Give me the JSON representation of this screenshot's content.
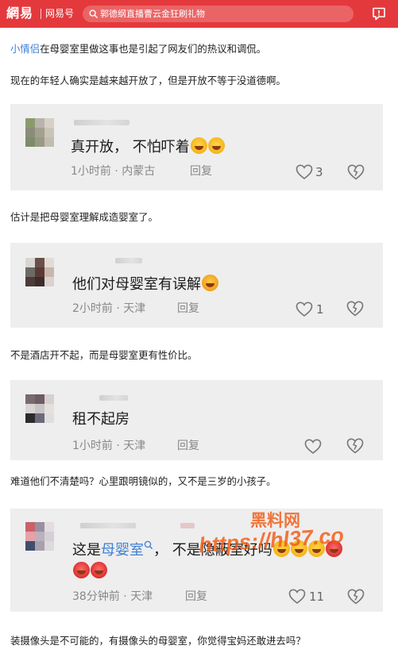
{
  "header": {
    "logo": "網易",
    "channel": "网易号",
    "search_text": "郭德纲直播曹云金狂刷礼物"
  },
  "article": {
    "p1_link": "小情侣",
    "p1_rest": "在母婴室里做这事也是引起了网友们的热议和调侃。",
    "p2": "现在的年轻人确实是越来越开放了，但是开放不等于没道德啊。",
    "p3": "估计是把母婴室理解成造婴室了。",
    "p4": "不是酒店开不起，而是母婴室更有性价比。",
    "p5": "难道他们不清楚吗？心里跟明镜似的，又不是三岁的小孩子。",
    "p6": "装摄像头是不可能的，有摄像头的母婴室，你觉得宝妈还敢进去吗？"
  },
  "comments": [
    {
      "text": "真开放， 不怕吓着",
      "time": "1小时前",
      "location": "内蒙古",
      "reply": "回复",
      "likes": "3"
    },
    {
      "text": "他们对母婴室有误解",
      "time": "2小时前",
      "location": "天津",
      "reply": "回复",
      "likes": "1"
    },
    {
      "text": "租不起房",
      "time": "1小时前",
      "location": "天津",
      "reply": "回复",
      "likes": ""
    },
    {
      "text_prefix": "这是",
      "text_tag": "母婴室",
      "text_suffix": "， 不是隐蔽室好吗",
      "time": "38分钟前",
      "location": "天津",
      "reply": "回复",
      "likes": "11"
    }
  ],
  "sep": "·",
  "watermark": {
    "line1": "黑料网",
    "line2": "https://hl37.co"
  },
  "colors": {
    "brand_red": "#e4393c",
    "link_blue": "#3d7fd6",
    "card_bg": "#eeeeee"
  }
}
